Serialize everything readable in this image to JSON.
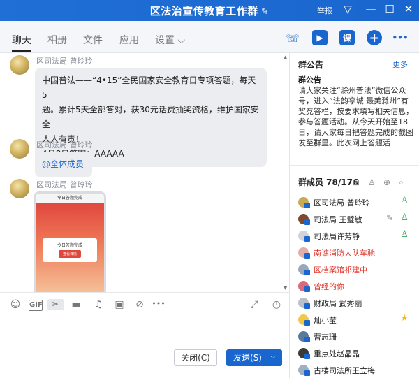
{
  "window": {
    "title": "区法治宣传教育工作群",
    "report": "举报",
    "edit_glyph": "✎",
    "pin_glyph": "▽",
    "min_glyph": "—",
    "max_glyph": "☐",
    "close_glyph": "✕"
  },
  "tabs": [
    {
      "label": "聊天"
    },
    {
      "label": "相册"
    },
    {
      "label": "文件"
    },
    {
      "label": "应用"
    },
    {
      "label": "设置 ⌵"
    }
  ],
  "toolbar_icons": {
    "phone": "☏",
    "video": "▶",
    "class_label": "课",
    "add": "+",
    "more": "•••"
  },
  "messages": [
    {
      "sender": "区司法局 曾玲玲",
      "lines": [
        "中国普法——“4•15”全民国家安全教育日专项答题，每天5",
        "题。累计5天全部答对，获30元话费抽奖资格，维护国家安全",
        "人人有责！",
        "4月8日答案：AAAAA"
      ]
    },
    {
      "sender": "区司法局 曾玲玲",
      "mention": "@全体成员"
    },
    {
      "sender": "区司法局 曾玲玲",
      "image": {
        "header": "今日答题完成",
        "card_title": "今日答题完成",
        "card_button": "查看详情"
      }
    }
  ],
  "input_tools": [
    "☺",
    "GIF",
    "✂",
    "▬",
    "♫",
    "▣",
    "⊘",
    "•••",
    "⤢",
    "◷"
  ],
  "buttons": {
    "close": "关闭(C)",
    "send": "发送(S)",
    "send_arrow": "⌵"
  },
  "announcement": {
    "title": "群公告",
    "more": "更多",
    "heading": "群公告",
    "body": "请大家关注“滁州普法”微信公众号，进入“法韵亭城·最美滁州”有奖竞答栏，按要求填写相关信息，参与答题活动。从今天开始至18日，请大家每日把答题完成的截图发至群里。此次网上答题活"
  },
  "members": {
    "title": "群成员 78/176",
    "icons": [
      "⊞",
      "♙",
      "⊕",
      "⌕"
    ],
    "list": [
      {
        "name": "区司法局 曾玲玲",
        "color": "#222222",
        "role": "admin-icon"
      },
      {
        "name": "司法局 王璧敏",
        "color": "#222222",
        "role": "admin-icon",
        "edit": true
      },
      {
        "name": "司法局许芳静",
        "color": "#222222",
        "role": "admin-icon"
      },
      {
        "name": "南谯消防大队车驰",
        "color": "#e0342a"
      },
      {
        "name": "区档案馆祁建中",
        "color": "#e0342a"
      },
      {
        "name": "曾经的你",
        "color": "#e0342a"
      },
      {
        "name": "财政局 武秀丽",
        "color": "#222222"
      },
      {
        "name": "灿小莹",
        "color": "#222222",
        "role": "star-icon"
      },
      {
        "name": "曹志珊",
        "color": "#222222"
      },
      {
        "name": "重点处赵晶晶",
        "color": "#222222"
      },
      {
        "name": "古楼司法所王立梅",
        "color": "#222222"
      }
    ]
  },
  "colors": {
    "accent": "#1a66cf",
    "red_name": "#e0342a",
    "bubble": "#ebedf0"
  }
}
